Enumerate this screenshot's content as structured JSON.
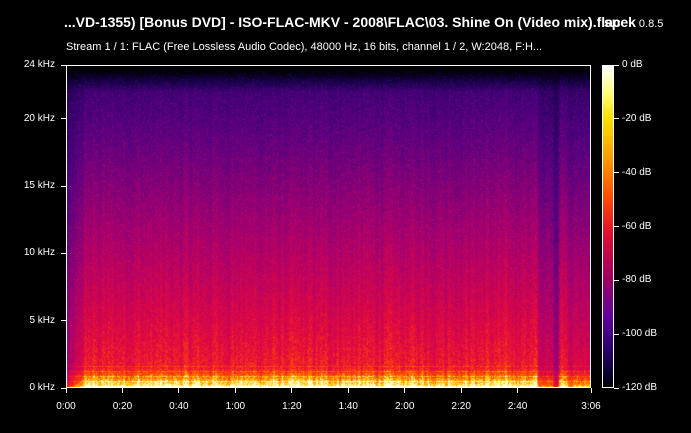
{
  "window": {
    "title": "...VD-1355) [Bonus DVD] - ISO-FLAC-MKV - 2008\\FLAC\\03. Shine On (Video mix).flac",
    "app_name": "spek",
    "app_version": "0.8.5",
    "stream_info": "Stream 1 / 1: FLAC (Free Lossless Audio Codec), 48000 Hz, 16 bits, channel 1 / 2, W:2048, F:H..."
  },
  "spectrogram": {
    "freq_axis_labels": [
      "24 kHz",
      "20 kHz",
      "15 kHz",
      "10 kHz",
      "5 kHz",
      "0 kHz"
    ],
    "freq_axis_values_khz": [
      24,
      20,
      15,
      10,
      5,
      0
    ],
    "time_axis_labels": [
      "0:00",
      "0:20",
      "0:40",
      "1:00",
      "1:20",
      "1:40",
      "2:00",
      "2:20",
      "2:40",
      "3:06"
    ],
    "time_axis_values_s": [
      0,
      20,
      40,
      60,
      80,
      100,
      120,
      140,
      160,
      186
    ],
    "duration_s": 186,
    "max_freq_khz": 24,
    "colors": {
      "background": "#000000",
      "low": "#140050",
      "mid": "#b00070",
      "high": "#ff2020",
      "peak": "#ffd000"
    }
  },
  "colorbar": {
    "labels": [
      "0 dB",
      "-20 dB",
      "-40 dB",
      "-60 dB",
      "-80 dB",
      "-100 dB",
      "-120 dB"
    ],
    "values_db": [
      0,
      -20,
      -40,
      -60,
      -80,
      -100,
      -120
    ]
  }
}
